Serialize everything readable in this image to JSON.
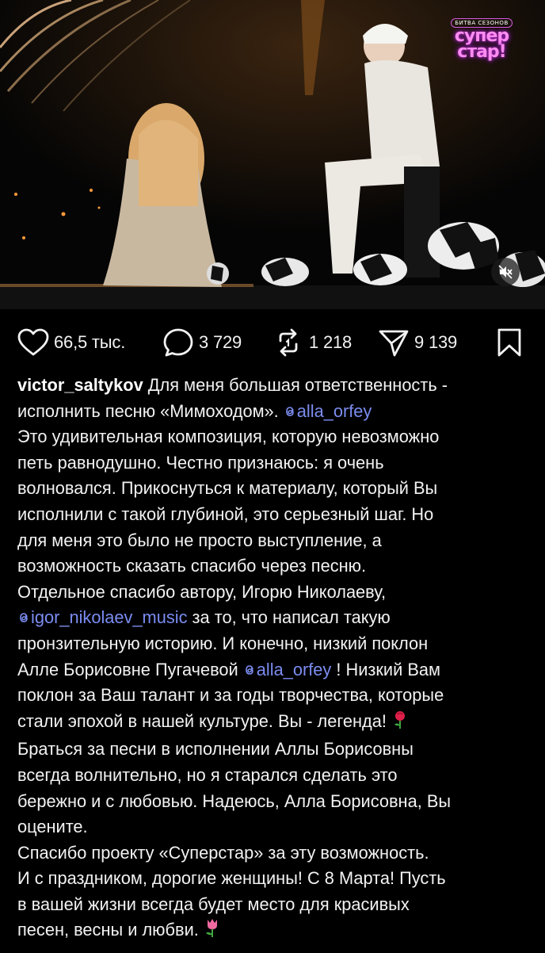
{
  "post": {
    "media": {
      "logo_small": "БИТВА СЕЗОНОВ",
      "logo_main": "супер стар!",
      "mute_icon": "speaker-muted-icon"
    },
    "actions": {
      "likes": "66,5 тыс.",
      "comments": "3 729",
      "reposts": "1 218",
      "shares": "9 139"
    },
    "caption": {
      "username": "victor_saltykov",
      "lines": [
        {
          "text": " Для меня большая ответственность -"
        },
        {
          "text": "исполнить песню «Мимоходом». ",
          "mention": "alla_orfey"
        },
        {
          "text": "Это удивительная композиция, которую невозможно"
        },
        {
          "text": "петь равнодушно. Честно признаюсь: я очень"
        },
        {
          "text": "волновался. Прикоснуться к материалу, который Вы"
        },
        {
          "text": "исполнили с такой глубиной, это серьезный шаг. Но"
        },
        {
          "text": "для меня это было не просто выступление, а"
        },
        {
          "text": "возможность сказать спасибо через песню."
        },
        {
          "text": "Отдельное спасибо автору, Игорю Николаеву,"
        },
        {
          "mention": "igor_nikolaev_music",
          "after": " за то, что написал такую"
        },
        {
          "text": "пронзительную историю. И конечно, низкий поклон"
        },
        {
          "text": "Алле Борисовне Пугачевой ",
          "mention": "alla_orfey",
          "after": " ! Низкий Вам"
        },
        {
          "text": "поклон за Ваш талант и за годы творчества, которые"
        },
        {
          "text": "стали эпохой в нашей культуре. Вы - легенда! ",
          "emoji": "rose"
        },
        {
          "text": "Браться за песни в исполнении Аллы Борисовны"
        },
        {
          "text": "всегда волнительно, но я старался сделать это"
        },
        {
          "text": "бережно и с любовью. Надеюсь, Алла Борисовна, Вы"
        },
        {
          "text": "оцените."
        },
        {
          "text": "Спасибо проекту «Суперстар» за эту возможность."
        },
        {
          "text": "И с праздником, дорогие женщины! С 8 Марта! Пусть"
        },
        {
          "text": "в вашей жизни всегда будет место для красивых"
        },
        {
          "text": "песен, весны и любви. ",
          "emoji": "tulip"
        }
      ]
    }
  }
}
